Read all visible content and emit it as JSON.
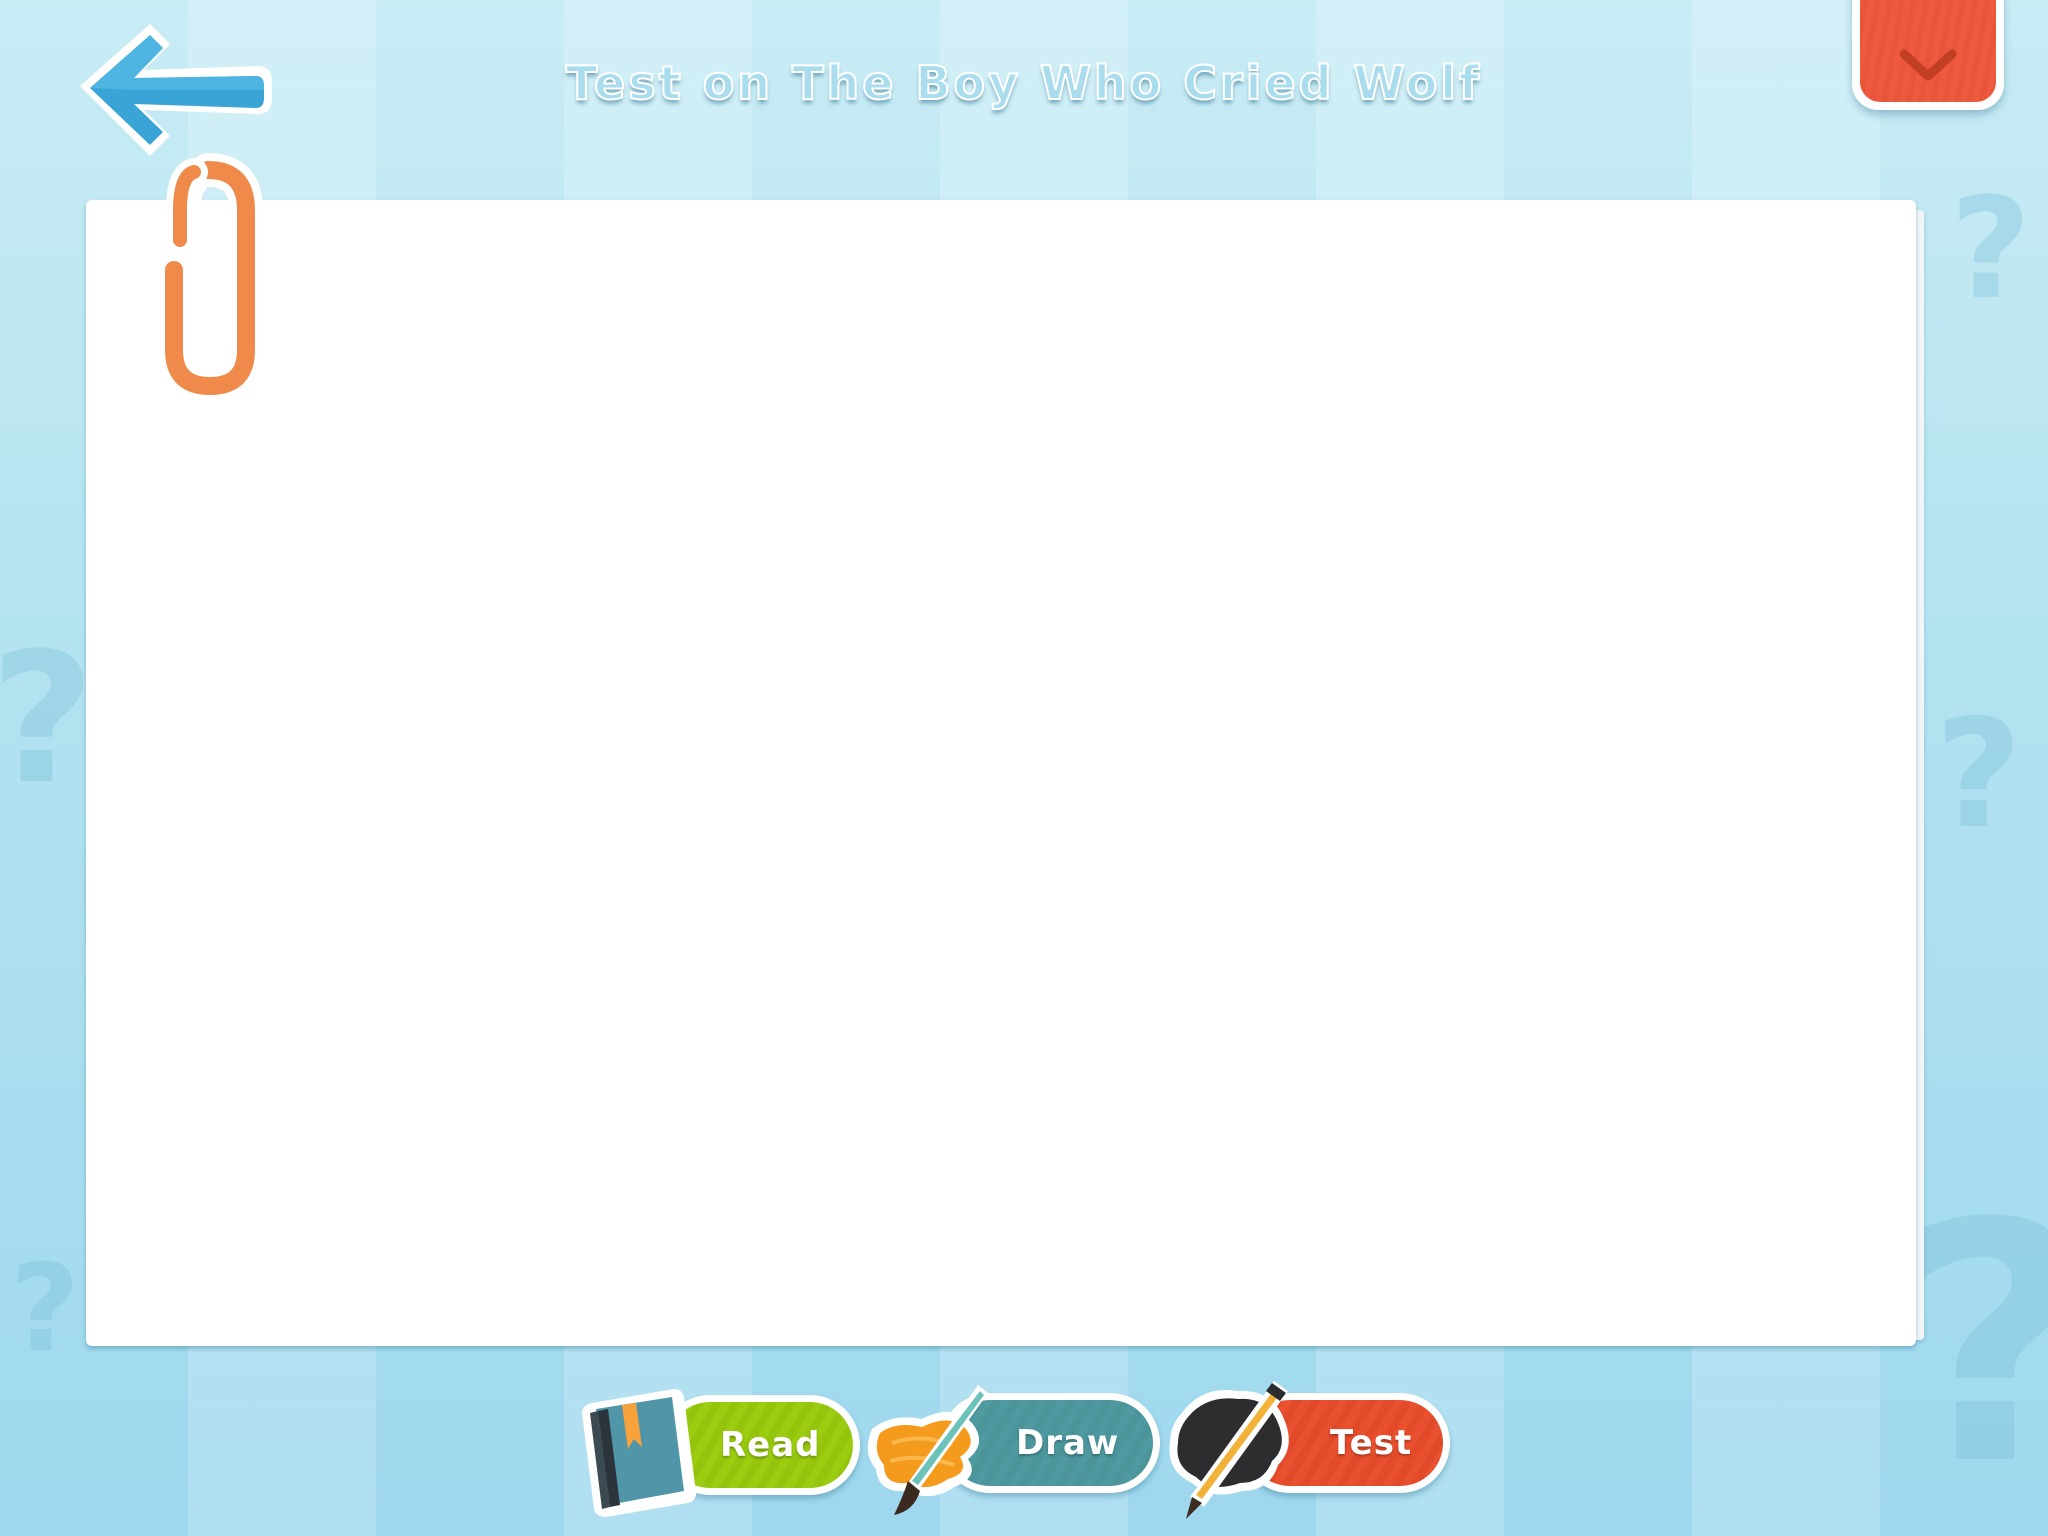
{
  "header": {
    "title": "Test on The Boy Who Cried Wolf",
    "back_icon": "back-arrow-icon",
    "menu_icon": "chevron-down-icon"
  },
  "content": {
    "paper_icon": "paperclip-icon"
  },
  "tabs": [
    {
      "label": "Read",
      "icon": "book-icon",
      "color": "#9ccc10"
    },
    {
      "label": "Draw",
      "icon": "paintbrush-icon",
      "color": "#4e9aa0"
    },
    {
      "label": "Test",
      "icon": "pencil-icon",
      "color": "#e9502f"
    }
  ],
  "colors": {
    "background": "#b2e2f0",
    "accent_blue": "#3ba4d6",
    "menu_red": "#ee5a3f",
    "clip_orange": "#f08a4b"
  }
}
